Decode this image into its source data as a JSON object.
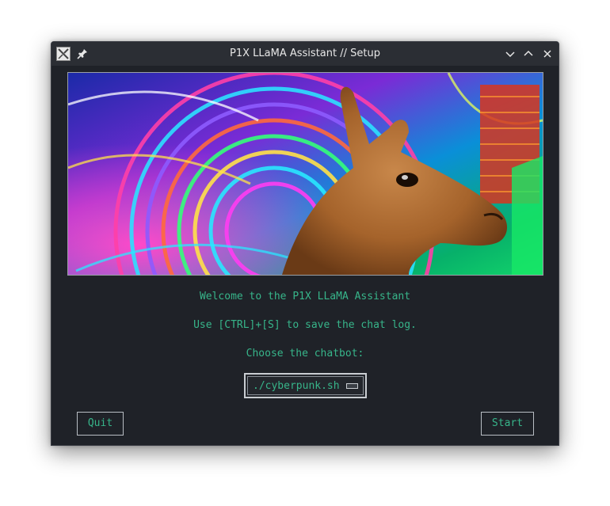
{
  "window": {
    "title": "P1X LLaMA Assistant // Setup",
    "icons": {
      "app": "app-icon",
      "pin": "pin-icon",
      "minimize": "chevron-down-icon",
      "maximize": "chevron-up-icon",
      "close": "close-icon"
    }
  },
  "content": {
    "banner_description": "psychedelic-llama-banner",
    "welcome_text": "Welcome to the P1X LLaMA Assistant",
    "hint_text": "Use [CTRL]+[S] to save the chat log.",
    "choose_label": "Choose the chatbot:",
    "chatbot_select": {
      "value": "./cyberpunk.sh"
    },
    "quit_label": "Quit",
    "start_label": "Start"
  },
  "colors": {
    "background": "#1f2228",
    "titlebar": "#2b2e34",
    "accent_text": "#37b58a",
    "border": "#b9bec4"
  }
}
